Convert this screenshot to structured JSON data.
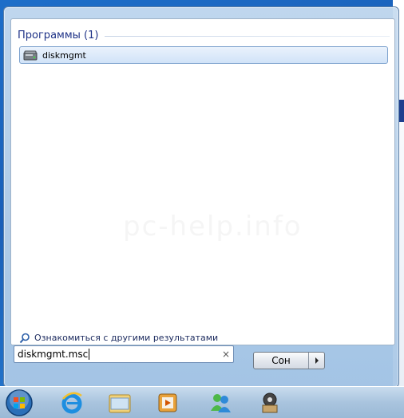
{
  "start_menu": {
    "group_title": "Программы (1)",
    "results": [
      {
        "label": "diskmgmt",
        "icon": "disk-management-icon"
      }
    ],
    "more_results_label": "Ознакомиться с другими результатами",
    "search": {
      "value": "diskmgmt.msc"
    },
    "clear_symbol": "×",
    "shutdown_label": "Сон"
  },
  "taskbar": {
    "items": [
      "start-orb",
      "internet-explorer",
      "file-explorer",
      "media-player",
      "messenger",
      "app-launcher"
    ]
  },
  "colors": {
    "accent": "#1e3287",
    "selection_border": "#7da2ce",
    "taskbar_top": "#c9dcee"
  }
}
